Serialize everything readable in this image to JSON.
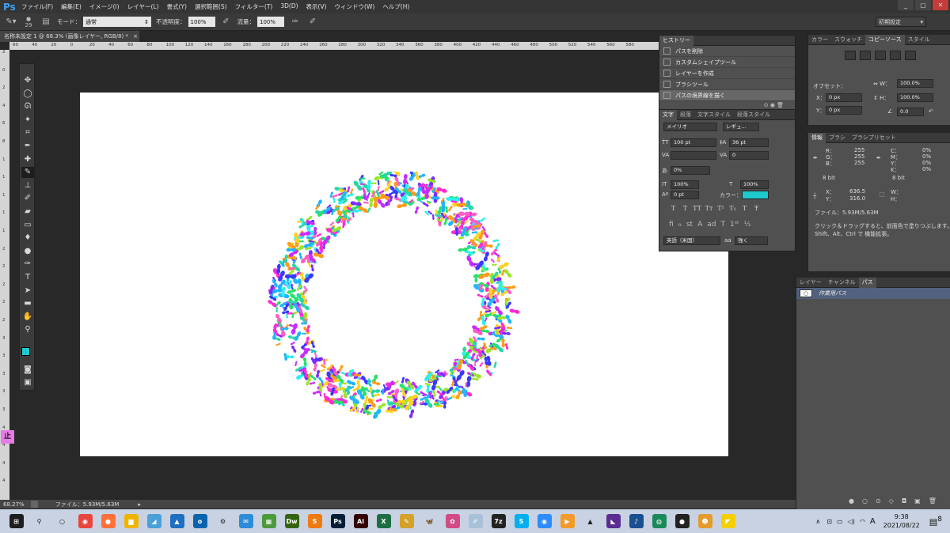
{
  "app": {
    "logo": "Ps"
  },
  "menu": [
    "ファイル(F)",
    "編集(E)",
    "イメージ(I)",
    "レイヤー(L)",
    "書式(Y)",
    "選択範囲(S)",
    "フィルター(T)",
    "3D(D)",
    "表示(V)",
    "ウィンドウ(W)",
    "ヘルプ(H)"
  ],
  "window_controls": [
    "_",
    "▢",
    "✕"
  ],
  "options": {
    "brush_size": "29",
    "mode_label": "モード：",
    "mode_value": "通常",
    "opacity_label": "不透明度：",
    "opacity_value": "100%",
    "flow_label": "流量：",
    "flow_value": "100%",
    "workspace": "初期設定"
  },
  "document": {
    "tab": "名称未設定 1 @ 68.3% (画像レイヤー, RGB/8) *",
    "close": "×"
  },
  "ruler": {
    "top": [
      "60",
      "40",
      "20",
      "0",
      "20",
      "40",
      "60",
      "80",
      "100",
      "120",
      "140",
      "160",
      "180",
      "200",
      "220",
      "240",
      "260",
      "280",
      "300",
      "320",
      "340",
      "360",
      "380",
      "400",
      "420",
      "440",
      "460",
      "480",
      "500",
      "520",
      "540",
      "560",
      "580"
    ],
    "left": [
      "2",
      "0",
      "2",
      "4",
      "6",
      "8",
      "1",
      "1",
      "1",
      "1",
      "1",
      "2",
      "2",
      "2",
      "2",
      "2",
      "3",
      "3",
      "3",
      "3",
      "3",
      "4",
      "4",
      "4",
      "4"
    ]
  },
  "stop_badge": "止",
  "status": {
    "zoom": "68.27%",
    "file": "ファイル：5.93M/5.63M"
  },
  "history": {
    "tabs": [
      "ヒストリー"
    ],
    "items": [
      "パスを削除",
      "カスタムシェイプツール",
      "レイヤーを作成",
      "ブラシツール",
      "パスの境界線を描く"
    ]
  },
  "character": {
    "tabs": [
      "文字",
      "段落",
      "文字スタイル",
      "段落スタイル"
    ],
    "font": "メイリオ",
    "style": "レギュ...",
    "size": "100 pt",
    "leading": "36 pt",
    "tracking": "0",
    "scale_pct": "0%",
    "vscale": "100%",
    "hscale": "100%",
    "baseline": "0 pt",
    "color_label": "カラー：",
    "color": "#1ec9cc",
    "type_buttons": [
      "T",
      "T",
      "TT",
      "Tт",
      "T¹",
      "T₁",
      "T",
      "Ŧ"
    ],
    "lang": "英語（米国）",
    "aa": "強く"
  },
  "properties": {
    "tabs": [
      "カラー",
      "スウォッチ",
      "コピーソース",
      "スタイル"
    ],
    "offset_label": "オフセット：",
    "x": "0 px",
    "y": "0 px",
    "w": "100.0%",
    "h": "100.0%",
    "angle": "0.0"
  },
  "info": {
    "tabs": [
      "情報",
      "ブラシ",
      "ブラシプリセット"
    ],
    "rgb": [
      [
        "R：",
        "255"
      ],
      [
        "G：",
        "255"
      ],
      [
        "B：",
        "255"
      ]
    ],
    "cmyk": [
      [
        "C：",
        "0%"
      ],
      [
        "M：",
        "0%"
      ],
      [
        "Y：",
        "0%"
      ],
      [
        "K：",
        "0%"
      ]
    ],
    "bit1": "8 bit",
    "bit2": "8 bit",
    "x": "636.5",
    "y": "316.0",
    "file": "ファイル：5.93M/5.63M",
    "hint1": "クリック＆ドラッグすると、前面色で塗りつぶします。",
    "hint2": "Shift、Alt、Ctrl で 機能拡張。"
  },
  "layers": {
    "tabs": [
      "レイヤー",
      "チャンネル",
      "パス"
    ],
    "items": [
      "作業用パス"
    ]
  },
  "taskbar": {
    "icons": [
      {
        "name": "windows-icon",
        "bg": "#1e1e1e",
        "t": "⊞"
      },
      {
        "name": "search-icon",
        "bg": "transparent",
        "t": "⚲"
      },
      {
        "name": "cortana-icon",
        "bg": "transparent",
        "t": "○"
      },
      {
        "name": "chrome-icon",
        "bg": "#e8453c",
        "t": "◉"
      },
      {
        "name": "firefox-icon",
        "bg": "#ff7139",
        "t": "●"
      },
      {
        "name": "explorer-icon",
        "bg": "#f0b400",
        "t": "▆"
      },
      {
        "name": "app-icon-1",
        "bg": "#4aa0d8",
        "t": "◢"
      },
      {
        "name": "photos-icon",
        "bg": "#1d6fc2",
        "t": "▲"
      },
      {
        "name": "outlook-icon",
        "bg": "#0a64ad",
        "t": "o"
      },
      {
        "name": "settings-icon",
        "bg": "transparent",
        "t": "⚙"
      },
      {
        "name": "mail-icon",
        "bg": "#2e8bd8",
        "t": "✉"
      },
      {
        "name": "app-icon-2",
        "bg": "#4c9a3c",
        "t": "▦"
      },
      {
        "name": "dreamweaver-icon",
        "bg": "#35640f",
        "t": "Dw"
      },
      {
        "name": "sublime-icon",
        "bg": "#f07a12",
        "t": "S"
      },
      {
        "name": "photoshop-icon",
        "bg": "#001e36",
        "t": "Ps"
      },
      {
        "name": "illustrator-icon",
        "bg": "#330000",
        "t": "Ai"
      },
      {
        "name": "excel-icon",
        "bg": "#1d6f42",
        "t": "X"
      },
      {
        "name": "app-icon-3",
        "bg": "#d5a129",
        "t": "✎"
      },
      {
        "name": "butterfly-icon",
        "bg": "transparent",
        "t": "🦋"
      },
      {
        "name": "app-icon-4",
        "bg": "#d24a86",
        "t": "✿"
      },
      {
        "name": "app-icon-5",
        "bg": "#a7c1d8",
        "t": "✐"
      },
      {
        "name": "7zip-icon",
        "bg": "#222",
        "t": "7z"
      },
      {
        "name": "skype-icon",
        "bg": "#00aff0",
        "t": "S"
      },
      {
        "name": "zoom-icon",
        "bg": "#2d8cff",
        "t": "◉"
      },
      {
        "name": "app-icon-6",
        "bg": "#f29b2c",
        "t": "▶"
      },
      {
        "name": "vlc-icon",
        "bg": "transparent",
        "t": "▲"
      },
      {
        "name": "app-icon-7",
        "bg": "#5a2d91",
        "t": "◣"
      },
      {
        "name": "music-icon",
        "bg": "#1a4f91",
        "t": "♪"
      },
      {
        "name": "app-icon-8",
        "bg": "#1b8a5a",
        "t": "◍"
      },
      {
        "name": "record-icon",
        "bg": "#222",
        "t": "●"
      },
      {
        "name": "app-icon-9",
        "bg": "#e39b2a",
        "t": "☻"
      },
      {
        "name": "app-icon-10",
        "bg": "#f5d000",
        "t": "◤"
      }
    ],
    "time": "9:38",
    "date": "2021/08/22",
    "ime": "A",
    "notif": "8"
  }
}
